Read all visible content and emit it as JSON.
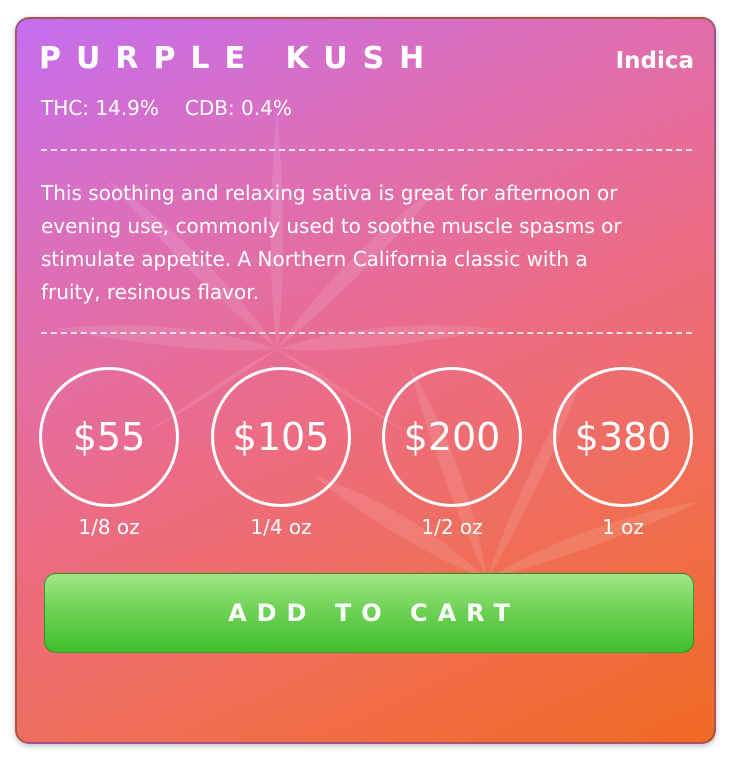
{
  "product": {
    "name": "PURPLE KUSH",
    "strain_type": "Indica",
    "thc": "THC: 14.9%",
    "cbd": "CDB: 0.4%",
    "description": "This soothing and relaxing sativa is great for afternoon or evening use, commonly used to soothe muscle spasms or stimulate appetite. A Northern California classic with a fruity, resinous flavor."
  },
  "prices": [
    {
      "price": "$55",
      "weight": "1/8 oz"
    },
    {
      "price": "$105",
      "weight": "1/4 oz"
    },
    {
      "price": "$200",
      "weight": "1/2 oz"
    },
    {
      "price": "$380",
      "weight": "1 oz"
    }
  ],
  "actions": {
    "add_to_cart_label": "ADD TO CART"
  },
  "colors": {
    "gradient_start": "#c46ef0",
    "gradient_end": "#ef6a22",
    "button_green": "#4cc235",
    "text": "#ffffff"
  },
  "icons": {
    "background": "cannabis-leaf-pattern"
  }
}
